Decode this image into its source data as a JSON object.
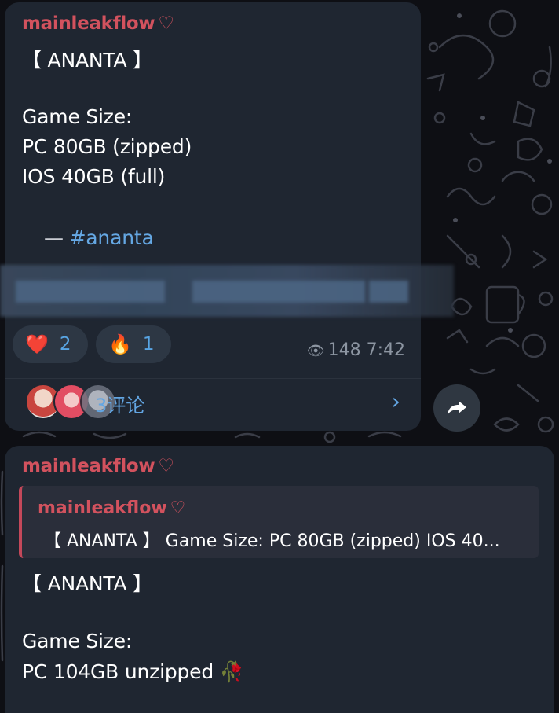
{
  "background_color": "#0e0f14",
  "bubble_color": "#1f2631",
  "accent_sender": "#d2525e",
  "accent_link": "#65a8e4",
  "post1": {
    "sender": "mainleakflow",
    "sender_heart": "♡",
    "lines": [
      "【 ANANTA 】",
      "Game Size:",
      "PC 80GB (zipped)",
      "IOS 40GB (full)"
    ],
    "dash": "—",
    "hashtag": "#ananta",
    "reactions": [
      {
        "emoji": "❤️",
        "icon": "heart-icon",
        "count": "2"
      },
      {
        "emoji": "🔥",
        "icon": "fire-icon",
        "count": "1"
      }
    ],
    "views_icon": "eye-icon",
    "views": "148",
    "time": "7:42",
    "comments_label": "评论",
    "comments_count": "3",
    "chevron": "›"
  },
  "share_icon": "share-arrow-icon",
  "post2": {
    "sender": "mainleakflow",
    "sender_heart": "♡",
    "quote": {
      "sender": "mainleakflow",
      "sender_heart": "♡",
      "text": "【 ANANTA 】   Game Size:  PC 80GB (zipped) IOS 40..."
    },
    "lines": [
      "【 ANANTA 】",
      "Game Size:",
      "PC 104GB unzipped"
    ],
    "trailing_emoji": "🥀"
  }
}
